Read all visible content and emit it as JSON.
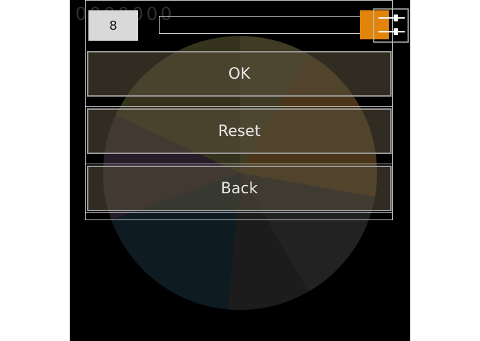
{
  "game": {
    "score": "0000000",
    "slider": {
      "value": "8",
      "fraction": 0.97
    },
    "menu": {
      "ok_label": "OK",
      "reset_label": "Reset",
      "back_label": "Back"
    },
    "colors": {
      "accent": "#e0850a",
      "wheel_slices": [
        "#5a5530",
        "#7a4a20",
        "#3a2c3a",
        "#1a2a30",
        "#2a2a2a",
        "#4a4a2a"
      ]
    }
  }
}
